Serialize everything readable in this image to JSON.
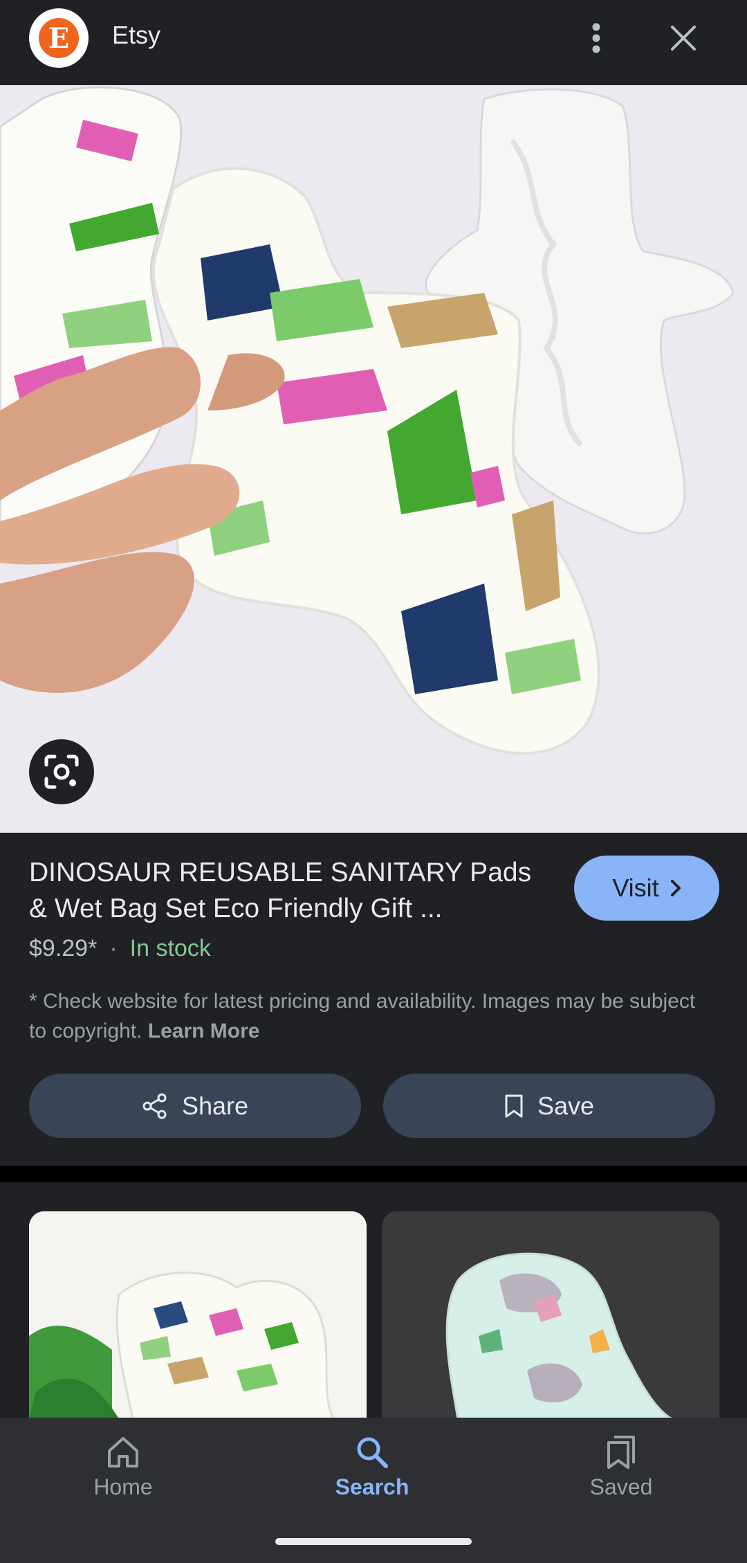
{
  "header": {
    "site_name": "Etsy",
    "logo_letter": "E",
    "more_icon": "more-vert-icon",
    "close_icon": "close-icon"
  },
  "product": {
    "title": "DINOSAUR REUSABLE SANITARY Pads & Wet Bag Set Eco Friendly Gift ...",
    "visit_label": "Visit",
    "price": "$9.29*",
    "separator": "·",
    "stock_status": "In stock",
    "disclaimer": "* Check website for latest pricing and availability. Images may be subject to copyright.",
    "learn_more": "Learn More",
    "share_label": "Share",
    "save_label": "Save"
  },
  "bottom_nav": {
    "items": [
      {
        "label": "Home",
        "icon": "home-icon"
      },
      {
        "label": "Search",
        "icon": "search-icon",
        "active": true
      },
      {
        "label": "Saved",
        "icon": "bookmarks-icon"
      }
    ]
  },
  "colors": {
    "background": "#202124",
    "accent": "#8ab4f8",
    "in_stock": "#81c995",
    "button_bg": "#394457",
    "etsy_orange": "#f1641e"
  }
}
